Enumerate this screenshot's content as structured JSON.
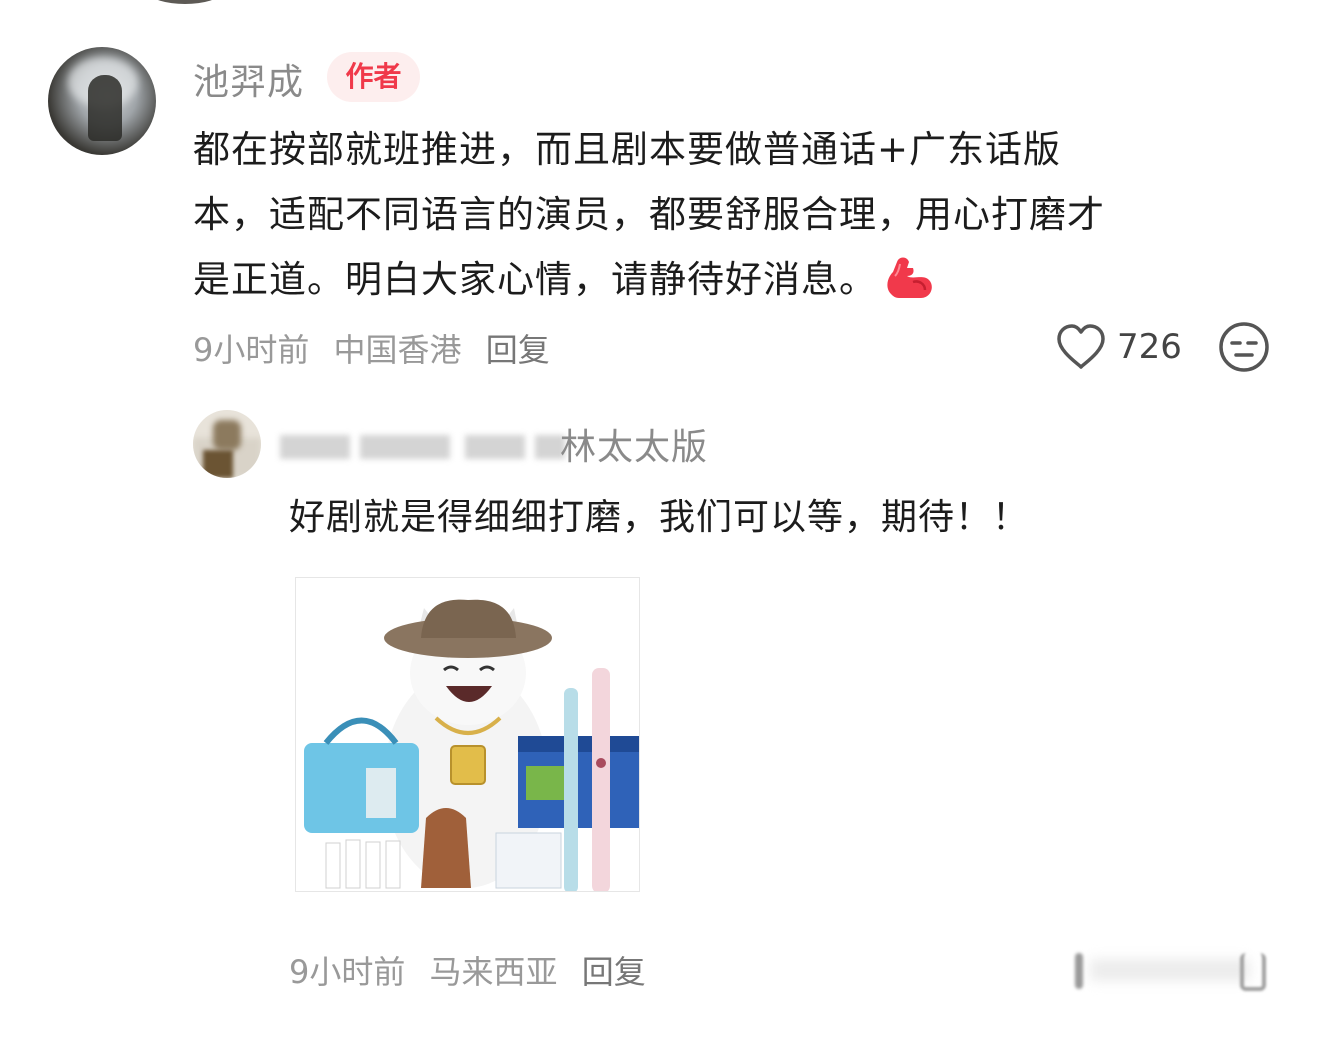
{
  "main_comment": {
    "author": "池羿成",
    "badge": "作者",
    "text_lines": [
      "都在按部就班推进，而且剧本要做普通话+广东话版",
      "本，适配不同语言的演员，都要舒服合理，用心打磨才",
      "是正道。明白大家心情，请静待好消息。"
    ],
    "emoji": "flexed-biceps-emoji",
    "time": "9小时前",
    "location": "中国香港",
    "reply_label": "回复",
    "like_count": "726"
  },
  "reply": {
    "author_visible_suffix": "林太太版",
    "text": "好剧就是得细细打磨，我们可以等，期待！！",
    "image_description_icon": "cat-meme-image",
    "time": "9小时前",
    "location": "马来西亚",
    "reply_label": "回复"
  },
  "colors": {
    "badge_bg": "#fdeeee",
    "badge_text": "#f0394a",
    "meta_text": "#999999",
    "body_text": "#1c1c1c"
  }
}
